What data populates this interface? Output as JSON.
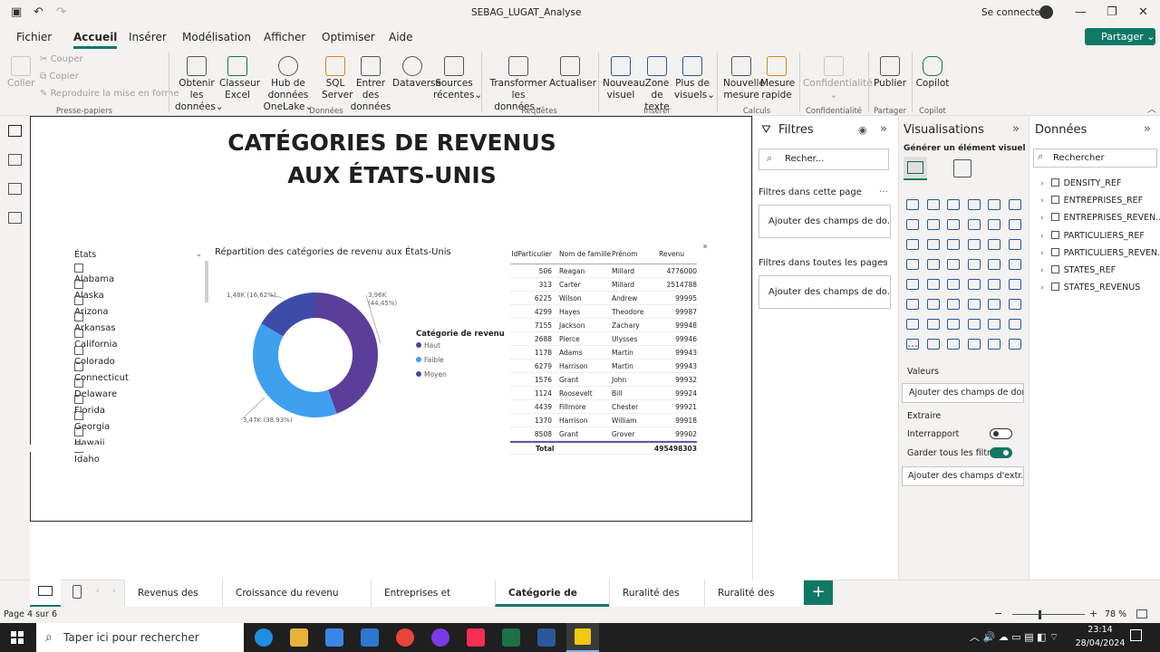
{
  "window": {
    "title": "SEBAG_LUGAT_Analyse",
    "signin": "Se connecter"
  },
  "menu": [
    "Fichier",
    "Accueil",
    "Insérer",
    "Modélisation",
    "Afficher",
    "Optimiser",
    "Aide"
  ],
  "share_label": "Partager",
  "ribbon": {
    "clipboard": {
      "paste": "Coller",
      "cut": "Couper",
      "copy": "Copier",
      "format": "Reproduire la mise en forme",
      "group": "Presse-papiers"
    },
    "data": {
      "get1": "Obtenir les",
      "get2": "données",
      "excel1": "Classeur",
      "excel2": "Excel",
      "hub1": "Hub de données",
      "hub2": "OneLake",
      "sql1": "SQL",
      "sql2": "Server",
      "enter1": "Entrer des",
      "enter2": "données",
      "dataverse": "Dataverse",
      "recent1": "Sources",
      "recent2": "récentes",
      "group": "Données"
    },
    "queries": {
      "transform1": "Transformer les",
      "transform2": "données",
      "refresh": "Actualiser",
      "group": "Requêtes"
    },
    "insert": {
      "visual1": "Nouveau",
      "visual2": "visuel",
      "text1": "Zone de",
      "text2": "texte",
      "more1": "Plus de",
      "more2": "visuels",
      "group": "Insérer"
    },
    "calc": {
      "measure1": "Nouvelle",
      "measure2": "mesure",
      "quick1": "Mesure",
      "quick2": "rapide",
      "group": "Calculs"
    },
    "sensitivity": {
      "label": "Confidentialité",
      "group": "Confidentialité"
    },
    "share": {
      "publish": "Publier",
      "group": "Partager"
    },
    "copilot": {
      "label": "Copilot",
      "group": "Copilot"
    }
  },
  "report": {
    "title_line1": "CATÉGORIES DE REVENUS",
    "title_line2": "AUX ÉTATS-UNIS",
    "slicer_title": "États",
    "states": [
      "Alabama",
      "Alaska",
      "Arizona",
      "Arkansas",
      "California",
      "Colorado",
      "Connecticut",
      "Delaware",
      "Florida",
      "Georgia",
      "Hawaii",
      "Idaho"
    ],
    "donut_title": "Répartition des catégories de revenu aux États-Unis",
    "legend_title": "Catégorie de revenu",
    "table": {
      "headers": [
        "IdParticulier",
        "Nom de famille",
        "Prénom",
        "Revenu"
      ],
      "rows": [
        [
          "506",
          "Reagan",
          "Millard",
          "4776000"
        ],
        [
          "313",
          "Carter",
          "Millard",
          "2514788"
        ],
        [
          "6225",
          "Wilson",
          "Andrew",
          "99995"
        ],
        [
          "4299",
          "Hayes",
          "Theodore",
          "99987"
        ],
        [
          "7155",
          "Jackson",
          "Zachary",
          "99948"
        ],
        [
          "2688",
          "Pierce",
          "Ulysses",
          "99946"
        ],
        [
          "1178",
          "Adams",
          "Martin",
          "99943"
        ],
        [
          "6279",
          "Harrison",
          "Martin",
          "99943"
        ],
        [
          "1576",
          "Grant",
          "John",
          "99932"
        ],
        [
          "1124",
          "Roosevelt",
          "Bill",
          "99924"
        ],
        [
          "4439",
          "Fillmore",
          "Chester",
          "99921"
        ],
        [
          "1370",
          "Harrison",
          "William",
          "99918"
        ],
        [
          "8508",
          "Grant",
          "Grover",
          "99902"
        ]
      ],
      "total_label": "Total",
      "total_value": "495498303"
    }
  },
  "chart_data": {
    "type": "pie",
    "title": "Répartition des catégories de revenu aux États-Unis",
    "legend_title": "Catégorie de revenu",
    "legend_position": "right",
    "series": [
      {
        "name": "Haut",
        "value": 3960,
        "label": "3,96K (44,45%)",
        "color": "#5b3e9a"
      },
      {
        "name": "Faible",
        "value": 3470,
        "label": "3,47K (38,93%)",
        "color": "#3fa0f0"
      },
      {
        "name": "Moyen",
        "value": 1480,
        "label": "1,48K (16,62%)",
        "color": "#3f4ba8"
      }
    ]
  },
  "filters": {
    "title": "Filtres",
    "search": "Recher...",
    "this_page": "Filtres dans cette page",
    "all_pages": "Filtres dans toutes les pages",
    "add": "Ajouter des champs de do..."
  },
  "viz": {
    "title": "Visualisations",
    "build": "Générer un élément visuel",
    "values": "Valeurs",
    "values_add": "Ajouter des champs de don...",
    "drill": "Extraire",
    "cross_report": "Interrapport",
    "keep_filters": "Garder tous les filtres",
    "drill_add": "Ajouter des champs d'extr..."
  },
  "data_pane": {
    "title": "Données",
    "search": "Rechercher",
    "tables": [
      "DENSITY_REF",
      "ENTREPRISES_REF",
      "ENTREPRISES_REVEN...",
      "PARTICULIERS_REF",
      "PARTICULIERS_REVEN...",
      "STATES_REF",
      "STATES_REVENUS"
    ]
  },
  "tabs": [
    "Revenus des États",
    "Croissance du revenu des États",
    "Entreprises et particuliers",
    "Catégorie de revenus",
    "Ruralité des États",
    "Ruralité des clients"
  ],
  "status": {
    "page": "Page 4 sur 6",
    "zoom": "78 %"
  },
  "taskbar": {
    "search": "Taper ici pour rechercher",
    "time": "23:14",
    "date": "28/04/2024"
  },
  "colors": {
    "accent": "#117865",
    "haut": "#5b3e9a",
    "faible": "#3fa0f0",
    "moyen": "#3f4ba8"
  }
}
